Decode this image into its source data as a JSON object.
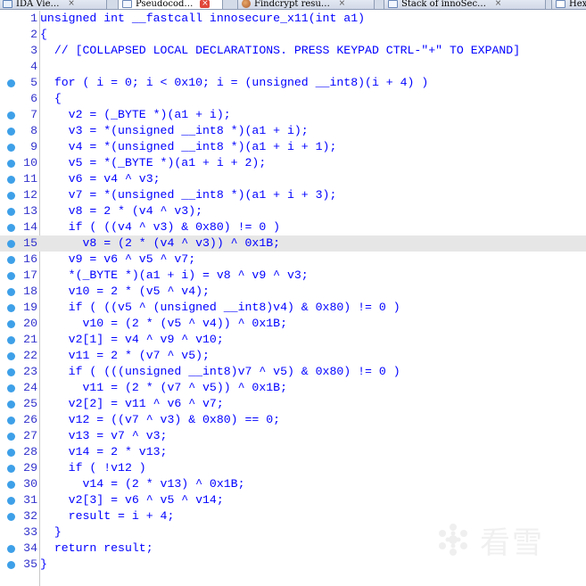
{
  "tabs": [
    {
      "label": "IDA Vie…",
      "icon": "ida-view-icon",
      "active": false
    },
    {
      "label": "Pseudocod…",
      "icon": "pseudocode-icon",
      "active": true
    },
    {
      "label": "Findcrypt resu…",
      "icon": "findcrypt-icon",
      "active": false
    },
    {
      "label": "Stack of innoSec…",
      "icon": "stack-icon",
      "active": false
    },
    {
      "label": "Hex",
      "icon": "hex-view-icon",
      "active": false
    }
  ],
  "tab_close_glyph": "×",
  "highlighted_line": 15,
  "lines": [
    {
      "num": "1",
      "bp": false,
      "text": "unsigned int __fastcall innosecure_x11(int a1)"
    },
    {
      "num": "2",
      "bp": false,
      "text": "{"
    },
    {
      "num": "3",
      "bp": false,
      "text": "  // [COLLAPSED LOCAL DECLARATIONS. PRESS KEYPAD CTRL-\"+\" TO EXPAND]"
    },
    {
      "num": "4",
      "bp": false,
      "text": ""
    },
    {
      "num": "5",
      "bp": true,
      "text": "  for ( i = 0; i < 0x10; i = (unsigned __int8)(i + 4) )"
    },
    {
      "num": "6",
      "bp": false,
      "text": "  {"
    },
    {
      "num": "7",
      "bp": true,
      "text": "    v2 = (_BYTE *)(a1 + i);"
    },
    {
      "num": "8",
      "bp": true,
      "text": "    v3 = *(unsigned __int8 *)(a1 + i);"
    },
    {
      "num": "9",
      "bp": true,
      "text": "    v4 = *(unsigned __int8 *)(a1 + i + 1);"
    },
    {
      "num": "10",
      "bp": true,
      "text": "    v5 = *(_BYTE *)(a1 + i + 2);"
    },
    {
      "num": "11",
      "bp": true,
      "text": "    v6 = v4 ^ v3;"
    },
    {
      "num": "12",
      "bp": true,
      "text": "    v7 = *(unsigned __int8 *)(a1 + i + 3);"
    },
    {
      "num": "13",
      "bp": true,
      "text": "    v8 = 2 * (v4 ^ v3);"
    },
    {
      "num": "14",
      "bp": true,
      "text": "    if ( ((v4 ^ v3) & 0x80) != 0 )"
    },
    {
      "num": "15",
      "bp": true,
      "text": "      v8 = (2 * (v4 ^ v3)) ^ 0x1B;"
    },
    {
      "num": "16",
      "bp": true,
      "text": "    v9 = v6 ^ v5 ^ v7;"
    },
    {
      "num": "17",
      "bp": true,
      "text": "    *(_BYTE *)(a1 + i) = v8 ^ v9 ^ v3;"
    },
    {
      "num": "18",
      "bp": true,
      "text": "    v10 = 2 * (v5 ^ v4);"
    },
    {
      "num": "19",
      "bp": true,
      "text": "    if ( ((v5 ^ (unsigned __int8)v4) & 0x80) != 0 )"
    },
    {
      "num": "20",
      "bp": true,
      "text": "      v10 = (2 * (v5 ^ v4)) ^ 0x1B;"
    },
    {
      "num": "21",
      "bp": true,
      "text": "    v2[1] = v4 ^ v9 ^ v10;"
    },
    {
      "num": "22",
      "bp": true,
      "text": "    v11 = 2 * (v7 ^ v5);"
    },
    {
      "num": "23",
      "bp": true,
      "text": "    if ( (((unsigned __int8)v7 ^ v5) & 0x80) != 0 )"
    },
    {
      "num": "24",
      "bp": true,
      "text": "      v11 = (2 * (v7 ^ v5)) ^ 0x1B;"
    },
    {
      "num": "25",
      "bp": true,
      "text": "    v2[2] = v11 ^ v6 ^ v7;"
    },
    {
      "num": "26",
      "bp": true,
      "text": "    v12 = ((v7 ^ v3) & 0x80) == 0;"
    },
    {
      "num": "27",
      "bp": true,
      "text": "    v13 = v7 ^ v3;"
    },
    {
      "num": "28",
      "bp": true,
      "text": "    v14 = 2 * v13;"
    },
    {
      "num": "29",
      "bp": true,
      "text": "    if ( !v12 )"
    },
    {
      "num": "30",
      "bp": true,
      "text": "      v14 = (2 * v13) ^ 0x1B;"
    },
    {
      "num": "31",
      "bp": true,
      "text": "    v2[3] = v6 ^ v5 ^ v14;"
    },
    {
      "num": "32",
      "bp": true,
      "text": "    result = i + 4;"
    },
    {
      "num": "33",
      "bp": false,
      "text": "  }"
    },
    {
      "num": "34",
      "bp": true,
      "text": "  return result;"
    },
    {
      "num": "35",
      "bp": true,
      "text": "}"
    }
  ],
  "watermark": {
    "text": "看雪",
    "icon": "kanxue-snowflake-logo"
  },
  "colors": {
    "code_text": "#0000ff",
    "line_number": "#3232cd",
    "breakpoint_dot": "#3ea0e8",
    "highlight_row": "#e6e6e6",
    "active_tab_close": "#e0463a"
  }
}
